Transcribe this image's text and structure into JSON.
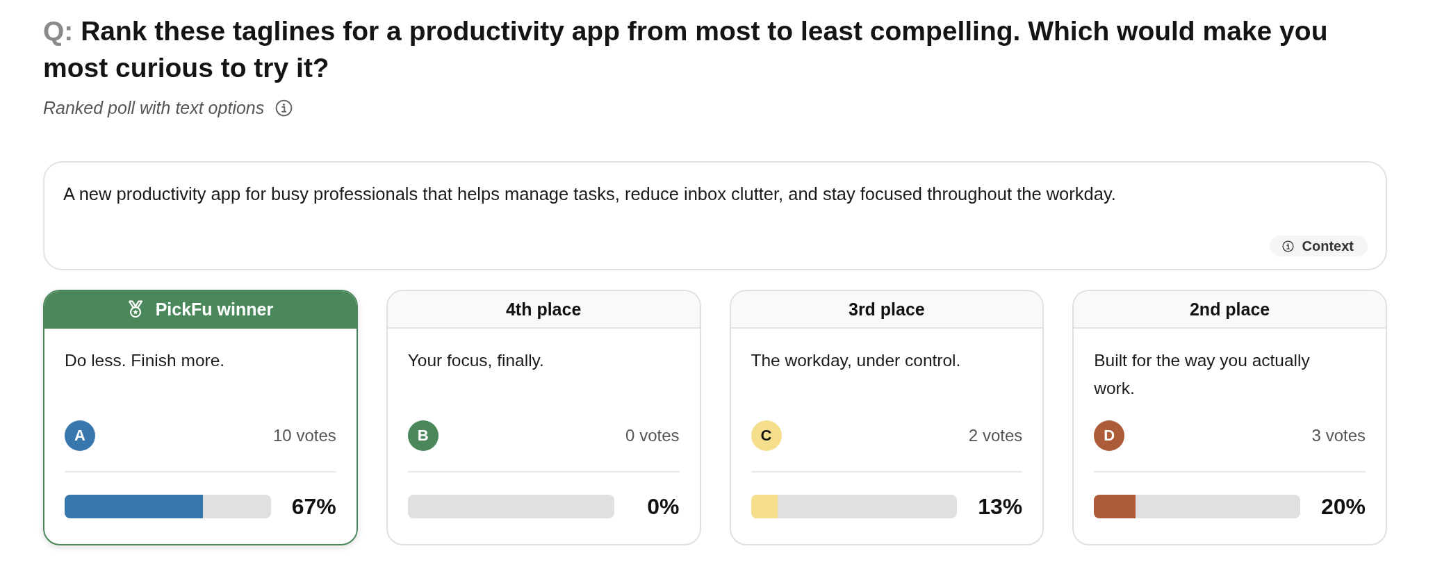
{
  "question": {
    "prefix": "Q:",
    "text": "Rank these taglines for a productivity app from most to least compelling. Which would make you most curious to try it?"
  },
  "poll_type": {
    "label": "Ranked poll with text options"
  },
  "context": {
    "text": "A new productivity app for busy professionals that helps manage tasks, reduce inbox clutter, and stay focused throughout the workday.",
    "button": "Context"
  },
  "options": [
    {
      "rank_label": "PickFu winner",
      "winner": true,
      "text": "Do less. Finish more.",
      "letter": "A",
      "color": "#3777ae",
      "votes": "10 votes",
      "level": 0.67,
      "percent": "67%"
    },
    {
      "rank_label": "4th place",
      "winner": false,
      "text": "Your focus, finally.",
      "letter": "B",
      "color": "#4a875a",
      "votes": "0 votes",
      "level": 0,
      "percent": "0%"
    },
    {
      "rank_label": "3rd place",
      "winner": false,
      "text": "The workday, under control.",
      "letter": "C",
      "color": "#f5df8c",
      "votes": "2 votes",
      "level": 0.13,
      "percent": "13%"
    },
    {
      "rank_label": "2nd place",
      "winner": false,
      "text": "Built for the way you actually work.",
      "letter": "D",
      "color": "#ac5c38",
      "votes": "3 votes",
      "level": 0.2,
      "percent": "20%"
    }
  ]
}
